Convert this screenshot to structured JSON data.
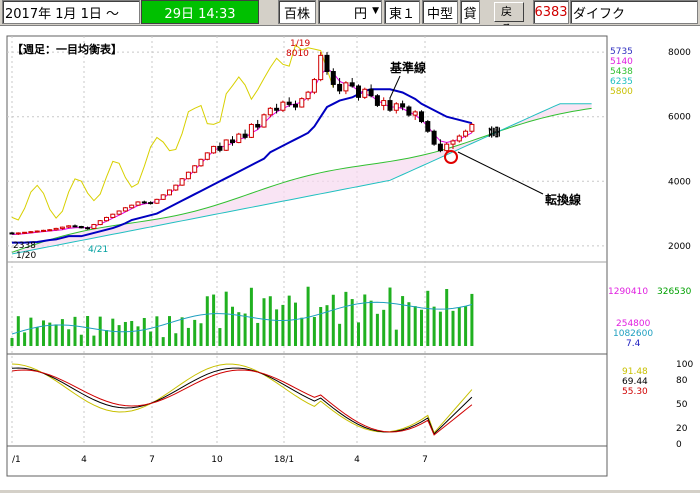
{
  "toolbar": {
    "start_date": "2017年 1月 1日 ～",
    "current_time": "29日 14:33",
    "unit": "百株",
    "currency": "円",
    "market": "東１",
    "size_class": "中型",
    "lend": "貸",
    "back_button": "戻る",
    "code": "6383",
    "company": "ダイフク"
  },
  "chart_title": "【週足：一目均衡表】",
  "annotations": {
    "high_date": "1/19",
    "high_price": "8010",
    "low_price": "2338",
    "low_date": "1/20",
    "mid_date": "4/21",
    "kijun": "基準線",
    "tenkan": "転換線",
    "cloud": "雲"
  },
  "price_axis": {
    "ticks": [
      "8000",
      "6000",
      "4000",
      "2000"
    ],
    "legend_values": [
      {
        "value": "5735",
        "color": "#3030c0"
      },
      {
        "value": "5140",
        "color": "#e020e0"
      },
      {
        "value": "5438",
        "color": "#30c030"
      },
      {
        "value": "6235",
        "color": "#20c0c0"
      },
      {
        "value": "5800",
        "color": "#d8d000"
      }
    ]
  },
  "volume_axis": {
    "volume": "1290410",
    "avg_volume": "326530",
    "value3": "254800",
    "value4": "1082600",
    "value5": "7.4"
  },
  "oscillator_axis": {
    "ticks": [
      "100",
      "80",
      "50",
      "20",
      "0"
    ],
    "values": [
      {
        "value": "91.48",
        "color": "#c8c000"
      },
      {
        "value": "69.44",
        "color": "#000000"
      },
      {
        "value": "55.30",
        "color": "#d00000"
      }
    ]
  },
  "x_axis_labels": [
    "/1",
    "4",
    "7",
    "10",
    "18/1",
    "4",
    "7"
  ],
  "chart_data": {
    "type": "candlestick",
    "title": "【週足：一目均衡表】",
    "x_labels": [
      "/1",
      "4",
      "7",
      "10",
      "18/1",
      "4",
      "7"
    ],
    "ylim": [
      1500,
      8500
    ],
    "price_ticks": [
      2000,
      4000,
      6000,
      8000
    ],
    "candles": [
      [
        2400,
        2430,
        2350,
        2380
      ],
      [
        2380,
        2420,
        2338,
        2400
      ],
      [
        2400,
        2430,
        2370,
        2420
      ],
      [
        2420,
        2460,
        2390,
        2440
      ],
      [
        2440,
        2480,
        2410,
        2460
      ],
      [
        2460,
        2500,
        2430,
        2480
      ],
      [
        2480,
        2520,
        2450,
        2500
      ],
      [
        2500,
        2560,
        2470,
        2540
      ],
      [
        2540,
        2600,
        2500,
        2580
      ],
      [
        2580,
        2640,
        2550,
        2620
      ],
      [
        2620,
        2660,
        2580,
        2600
      ],
      [
        2600,
        2620,
        2540,
        2560
      ],
      [
        2560,
        2600,
        2500,
        2540
      ],
      [
        2540,
        2680,
        2520,
        2660
      ],
      [
        2660,
        2800,
        2640,
        2780
      ],
      [
        2780,
        2900,
        2760,
        2880
      ],
      [
        2880,
        3000,
        2860,
        2980
      ],
      [
        2980,
        3100,
        2960,
        3080
      ],
      [
        3080,
        3200,
        3060,
        3180
      ],
      [
        3180,
        3280,
        3160,
        3260
      ],
      [
        3260,
        3380,
        3240,
        3360
      ],
      [
        3360,
        3400,
        3300,
        3340
      ],
      [
        3340,
        3380,
        3280,
        3320
      ],
      [
        3320,
        3460,
        3300,
        3440
      ],
      [
        3440,
        3600,
        3420,
        3580
      ],
      [
        3580,
        3750,
        3560,
        3730
      ],
      [
        3730,
        3900,
        3700,
        3880
      ],
      [
        3880,
        4100,
        3860,
        4080
      ],
      [
        4080,
        4300,
        4060,
        4280
      ],
      [
        4280,
        4500,
        4250,
        4480
      ],
      [
        4480,
        4700,
        4450,
        4680
      ],
      [
        4680,
        4900,
        4650,
        4880
      ],
      [
        4880,
        5100,
        4850,
        5080
      ],
      [
        5080,
        5200,
        4900,
        4960
      ],
      [
        4960,
        5300,
        4940,
        5280
      ],
      [
        5280,
        5400,
        5100,
        5200
      ],
      [
        5200,
        5500,
        5180,
        5460
      ],
      [
        5460,
        5600,
        5300,
        5360
      ],
      [
        5360,
        5800,
        5340,
        5760
      ],
      [
        5760,
        5900,
        5600,
        5680
      ],
      [
        5680,
        6100,
        5660,
        6060
      ],
      [
        6060,
        6300,
        5980,
        6260
      ],
      [
        6260,
        6400,
        6100,
        6200
      ],
      [
        6200,
        6500,
        6150,
        6450
      ],
      [
        6450,
        6600,
        6300,
        6380
      ],
      [
        6380,
        6500,
        6200,
        6300
      ],
      [
        6300,
        6600,
        6280,
        6560
      ],
      [
        6560,
        6800,
        6500,
        6760
      ],
      [
        6760,
        7200,
        6700,
        7150
      ],
      [
        7150,
        8010,
        7100,
        7900
      ],
      [
        7900,
        8000,
        7300,
        7400
      ],
      [
        7400,
        7500,
        6900,
        7000
      ],
      [
        7000,
        7200,
        6700,
        6800
      ],
      [
        6800,
        7100,
        6700,
        7050
      ],
      [
        7050,
        7200,
        6900,
        6950
      ],
      [
        6950,
        7000,
        6500,
        6600
      ],
      [
        6600,
        6900,
        6550,
        6850
      ],
      [
        6850,
        7000,
        6600,
        6650
      ],
      [
        6650,
        6700,
        6300,
        6350
      ],
      [
        6350,
        6600,
        6200,
        6500
      ],
      [
        6500,
        6600,
        6150,
        6200
      ],
      [
        6200,
        6450,
        6100,
        6400
      ],
      [
        6400,
        6500,
        6200,
        6300
      ],
      [
        6300,
        6350,
        6000,
        6050
      ],
      [
        6050,
        6200,
        5900,
        6150
      ],
      [
        6150,
        6200,
        5800,
        5850
      ],
      [
        5850,
        5900,
        5500,
        5550
      ],
      [
        5550,
        5600,
        5100,
        5150
      ],
      [
        5150,
        5300,
        4900,
        4950
      ],
      [
        4950,
        5200,
        4850,
        5150
      ],
      [
        5150,
        5300,
        5000,
        5250
      ],
      [
        5250,
        5450,
        5200,
        5400
      ],
      [
        5400,
        5600,
        5350,
        5550
      ],
      [
        5550,
        5800,
        5500,
        5760
      ]
    ],
    "series": [
      {
        "name": "基準線",
        "color": "#0000c0",
        "values": [
          2100,
          2100,
          2100,
          2110,
          2120,
          2150,
          2180,
          2200,
          2250,
          2300,
          2300,
          2300,
          2350,
          2400,
          2450,
          2500,
          2550,
          2620,
          2700,
          2800,
          2850,
          2900,
          2950,
          3000,
          3100,
          3200,
          3300,
          3400,
          3500,
          3600,
          3700,
          3800,
          3900,
          4000,
          4100,
          4200,
          4300,
          4400,
          4500,
          4600,
          4700,
          4900,
          5000,
          5100,
          5200,
          5300,
          5400,
          5500,
          5700,
          6000,
          6300,
          6400,
          6500,
          6550,
          6600,
          6700,
          6800,
          6850,
          6850,
          6850,
          6850,
          6800,
          6750,
          6650,
          6550,
          6400,
          6300,
          6200,
          6100,
          6000,
          5950,
          5900,
          5850,
          5800
        ]
      },
      {
        "name": "転換線",
        "color": "#e000e0",
        "values": [
          2350,
          2360,
          2380,
          2400,
          2420,
          2440,
          2460,
          2480,
          2500,
          2540,
          2560,
          2570,
          2560,
          2600,
          2680,
          2760,
          2860,
          2950,
          3050,
          3150,
          3250,
          3300,
          3330,
          3380,
          3480,
          3620,
          3780,
          3950,
          4150,
          4350,
          4550,
          4750,
          4950,
          5050,
          5100,
          5180,
          5300,
          5350,
          5500,
          5600,
          5800,
          6000,
          6150,
          6250,
          6350,
          6400,
          6450,
          6600,
          6900,
          7300,
          7500,
          7350,
          7100,
          7000,
          6950,
          6800,
          6700,
          6650,
          6500,
          6400,
          6300,
          6300,
          6250,
          6150,
          6050,
          5900,
          5700,
          5450,
          5250,
          5200,
          5250,
          5300,
          5400,
          5500
        ]
      }
    ],
    "legend": [
      "5735",
      "5140",
      "5438",
      "6235",
      "5800"
    ]
  }
}
